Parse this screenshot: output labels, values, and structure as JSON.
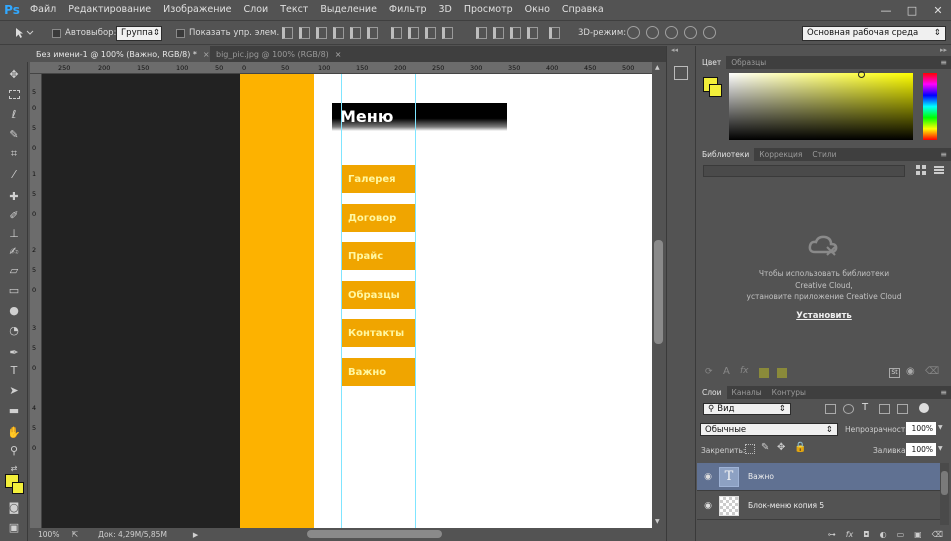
{
  "app": {
    "logo": "Ps",
    "menu": [
      "Файл",
      "Редактирование",
      "Изображение",
      "Слои",
      "Текст",
      "Выделение",
      "Фильтр",
      "3D",
      "Просмотр",
      "Окно",
      "Справка"
    ],
    "window_controls": [
      "—",
      "□",
      "✕"
    ]
  },
  "options_bar": {
    "tool_icon": "move-tool-icon",
    "autoselect_label": "Автовыбор:",
    "autoselect_value": "Группа",
    "show_transform_label": "Показать упр. элем.",
    "mode_3d_label": "3D-режим:",
    "workspace": "Основная рабочая среда"
  },
  "tabs": [
    {
      "label": "Без имени-1 @ 100% (Важно, RGB/8) *",
      "active": true
    },
    {
      "label": "big_pic.jpg @ 100% (RGB/8)",
      "active": false
    }
  ],
  "ruler": {
    "top_ticks": [
      "250",
      "200",
      "150",
      "100",
      "50",
      "0",
      "50",
      "100",
      "150",
      "200",
      "250",
      "300",
      "350",
      "400",
      "450",
      "500"
    ],
    "left_ticks": [
      "5",
      "0",
      "5",
      "0",
      "1",
      "5",
      "0",
      "2",
      "5",
      "0",
      "3",
      "5",
      "0",
      "4",
      "5",
      "0"
    ]
  },
  "document": {
    "menu_title": "Меню",
    "menu_items": [
      "Галерея",
      "Договор",
      "Прайс",
      "Образцы",
      "Контакты",
      "Важно"
    ]
  },
  "status": {
    "zoom": "100%",
    "doc_size": "Док: 4,29M/5,85M"
  },
  "color_panel": {
    "tabs": [
      "Цвет",
      "Образцы"
    ],
    "foreground": "#f3ef3a",
    "background": "#f3ef3a"
  },
  "libraries_panel": {
    "tabs": [
      "Библиотеки",
      "Коррекция",
      "Стили"
    ],
    "message_line1": "Чтобы использовать библиотеки",
    "message_line2": "Creative Cloud,",
    "message_line3": "установите приложение Creative Cloud",
    "install_link": "Установить"
  },
  "layers_panel": {
    "tabs": [
      "Слои",
      "Каналы",
      "Контуры"
    ],
    "filter": "Вид",
    "blend_mode": "Обычные",
    "opacity_label": "Непрозрачность:",
    "opacity_value": "100%",
    "lock_label": "Закрепить:",
    "fill_label": "Заливка:",
    "fill_value": "100%",
    "layers": [
      {
        "name": "Важно",
        "type": "text",
        "selected": true
      },
      {
        "name": "Блок-меню копия 5",
        "type": "raster",
        "selected": false
      }
    ]
  }
}
